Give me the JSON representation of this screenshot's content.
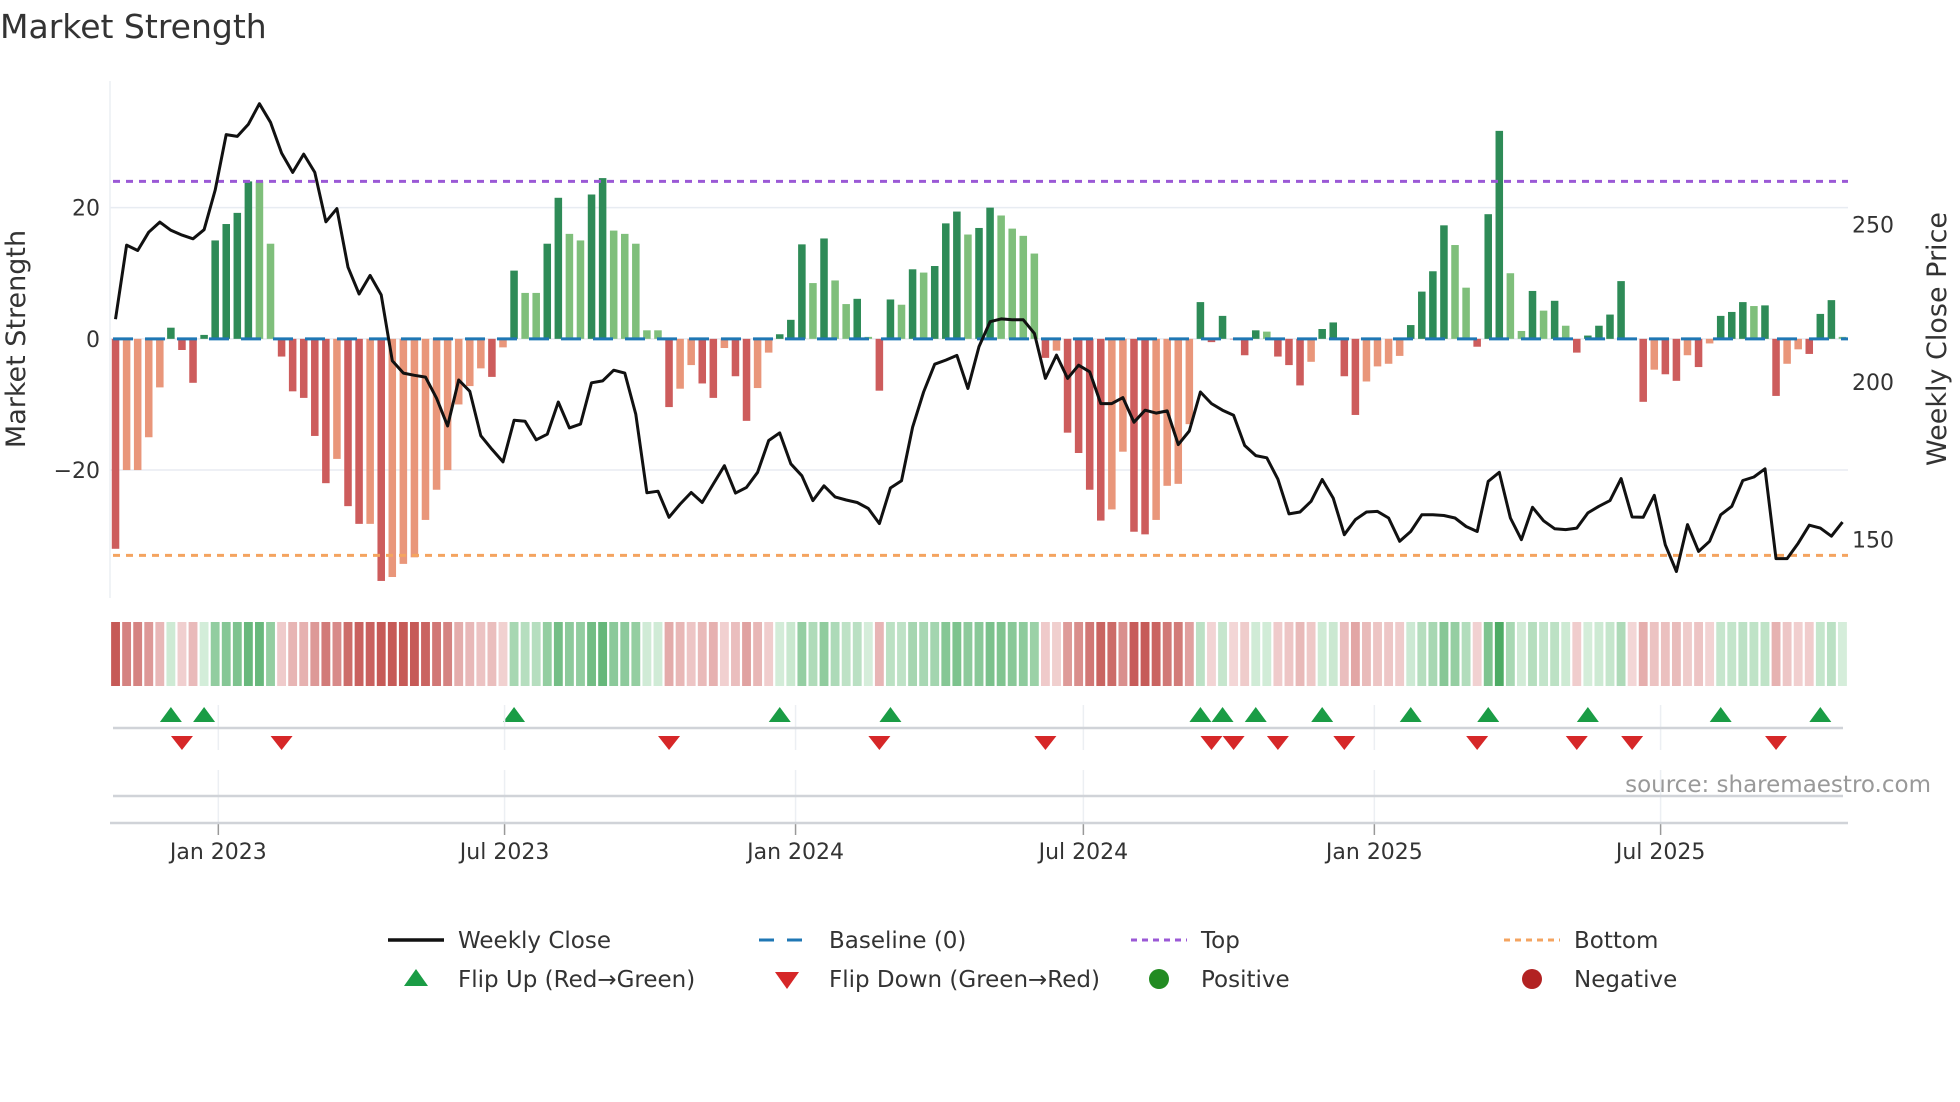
{
  "chart_data": {
    "type": "bar",
    "title": "Market Strength",
    "ylabel": "Market Strength",
    "y2label": "Weekly Close Price",
    "source": "source: sharemaestro.com",
    "start_date": "2022-10-28",
    "frequency": "weekly",
    "ylim": [
      -39.5,
      39.3
    ],
    "y2lim": [
      131.5,
      295.6
    ],
    "yticks": [
      {
        "v": 20,
        "label": "20"
      },
      {
        "v": 0,
        "label": "0"
      },
      {
        "v": -20,
        "label": "−20"
      }
    ],
    "y2ticks": [
      {
        "v": 250,
        "label": "250"
      },
      {
        "v": 200,
        "label": "200"
      },
      {
        "v": 150,
        "label": "150"
      }
    ],
    "xticks": [
      {
        "date": "2023-01-01",
        "label": "Jan 2023"
      },
      {
        "date": "2023-07-01",
        "label": "Jul 2023"
      },
      {
        "date": "2024-01-01",
        "label": "Jan 2024"
      },
      {
        "date": "2024-07-01",
        "label": "Jul 2024"
      },
      {
        "date": "2025-01-01",
        "label": "Jan 2025"
      },
      {
        "date": "2025-07-01",
        "label": "Jul 2025"
      }
    ],
    "top": 24,
    "bottom": -33,
    "baseline": 0,
    "strength": [
      -32,
      -20,
      -20,
      -15,
      -7.4,
      1.7,
      -1.7,
      -6.7,
      0.6,
      15,
      17.5,
      19.2,
      24,
      24,
      14.5,
      -2.7,
      -8,
      -9,
      -14.8,
      -22,
      -18.3,
      -25.5,
      -28.2,
      -28.2,
      -36.9,
      -36.3,
      -34.3,
      -33.3,
      -27.6,
      -23,
      -20,
      -10,
      -7.2,
      -4.5,
      -5.8,
      -1.3,
      10.4,
      7,
      7,
      14.5,
      21.5,
      16,
      15,
      22,
      24.5,
      16.5,
      16,
      14.5,
      1.3,
      1.3,
      -10.4,
      -7.6,
      -4,
      -6.8,
      -9,
      -1.4,
      -5.7,
      -12.5,
      -7.5,
      -2.1,
      0.7,
      2.9,
      14.4,
      8.5,
      15.3,
      8.9,
      5.3,
      6.1,
      0.3,
      -7.9,
      6,
      5.2,
      10.6,
      10.1,
      11.1,
      17.6,
      19.4,
      15.9,
      16.9,
      20,
      18.8,
      16.8,
      15.7,
      13,
      -2.9,
      -1.8,
      -14.3,
      -17.4,
      -23,
      -27.7,
      -26,
      -17.2,
      -29.4,
      -29.8,
      -27.6,
      -22.4,
      -22.1,
      -13,
      5.6,
      -0.5,
      3.5,
      0,
      -2.5,
      1.3,
      1.1,
      -2.7,
      -4,
      -7.1,
      -3.5,
      1.5,
      2.5,
      -5.7,
      -11.6,
      -6.5,
      -4.2,
      -3.8,
      -2.6,
      2.1,
      7.2,
      10.3,
      17.3,
      14.3,
      7.8,
      -1.2,
      19,
      31.7,
      10,
      1.2,
      7.3,
      4.3,
      5.8,
      2,
      -2.1,
      0.5,
      2,
      3.7,
      8.8,
      0,
      -9.6,
      -4.7,
      -5.4,
      -6.4,
      -2.5,
      -4.3,
      -0.7,
      3.5,
      4.1,
      5.6,
      5,
      5.1,
      -8.7,
      -3.8,
      -1.6,
      -2.3,
      3.8,
      5.9,
      0.3
    ],
    "weekly_close": [
      220.0,
      243.5,
      241.8,
      247.6,
      250.8,
      248.2,
      246.7,
      245.5,
      248.4,
      261.0,
      278.6,
      278.0,
      281.9,
      288.4,
      282.5,
      272.7,
      266.6,
      272.4,
      266.6,
      250.9,
      255.1,
      236.5,
      228.0,
      233.9,
      227.7,
      206.8,
      202.9,
      202.2,
      201.6,
      194.9,
      186.1,
      200.7,
      197.1,
      183.0,
      178.7,
      174.7,
      187.9,
      187.6,
      181.7,
      183.5,
      193.7,
      185.5,
      186.7,
      199.8,
      200.4,
      203.8,
      202.9,
      189.8,
      164.9,
      165.4,
      157.1,
      161.3,
      165,
      161.8,
      167.7,
      173.5,
      164.8,
      166.6,
      171.4,
      181.5,
      183.9,
      174.1,
      170.3,
      162.4,
      167.1,
      163.6,
      162.6,
      161.8,
      159.9,
      155.1,
      166.4,
      168.7,
      185.7,
      196.9,
      205.7,
      207,
      208.5,
      198,
      211.3,
      219.2,
      220.1,
      219.8,
      219.8,
      215.5,
      201.2,
      208.6,
      201.2,
      205.4,
      203.3,
      193.2,
      193.2,
      195.1,
      187.3,
      191.1,
      190.2,
      190.9,
      180.2,
      184.5,
      196.9,
      193.2,
      191.1,
      189.5,
      179.9,
      176.7,
      176,
      169.2,
      158.2,
      158.8,
      162.2,
      169.1,
      163.2,
      151.6,
      156.4,
      158.8,
      159,
      156.9,
      149.5,
      152.6,
      157.9,
      157.9,
      157.7,
      156.9,
      154.2,
      152.6,
      168.5,
      171.4,
      156.9,
      150,
      160.3,
      156,
      153.5,
      153.2,
      153.7,
      158.5,
      160.6,
      162.4,
      169.4,
      157.2,
      157.1,
      164.1,
      148.4,
      139.9,
      154.8,
      146.3,
      149.5,
      157.9,
      160.6,
      168.8,
      169.9,
      172.5,
      144,
      144,
      148.9,
      154.6,
      153.7,
      151.1,
      155.6
    ],
    "legend": {
      "placement": "bottom",
      "items": [
        {
          "label": "Weekly Close",
          "kind": "line"
        },
        {
          "label": "Baseline (0)",
          "kind": "dash"
        },
        {
          "label": "Top",
          "kind": "dot-purple"
        },
        {
          "label": "Bottom",
          "kind": "dot-orange"
        },
        {
          "label": "Flip Up (Red→Green)",
          "kind": "tri-up"
        },
        {
          "label": "Flip Down (Green→Red)",
          "kind": "tri-down"
        },
        {
          "label": "Positive",
          "kind": "circle-green"
        },
        {
          "label": "Negative",
          "kind": "circle-red"
        }
      ]
    },
    "colors": {
      "pos_strong": "#2e8b57",
      "pos_weak": "#7fbf7b",
      "neg_strong": "#cd5c5c",
      "neg_weak": "#e9967a",
      "line": "#111111",
      "baseline": "#1f77b4",
      "top": "#9b59d6",
      "bottom": "#f4a460",
      "flip_up": "#1a9c45",
      "flip_down": "#d62728",
      "positive": "#228b22",
      "negative": "#b22222"
    }
  }
}
